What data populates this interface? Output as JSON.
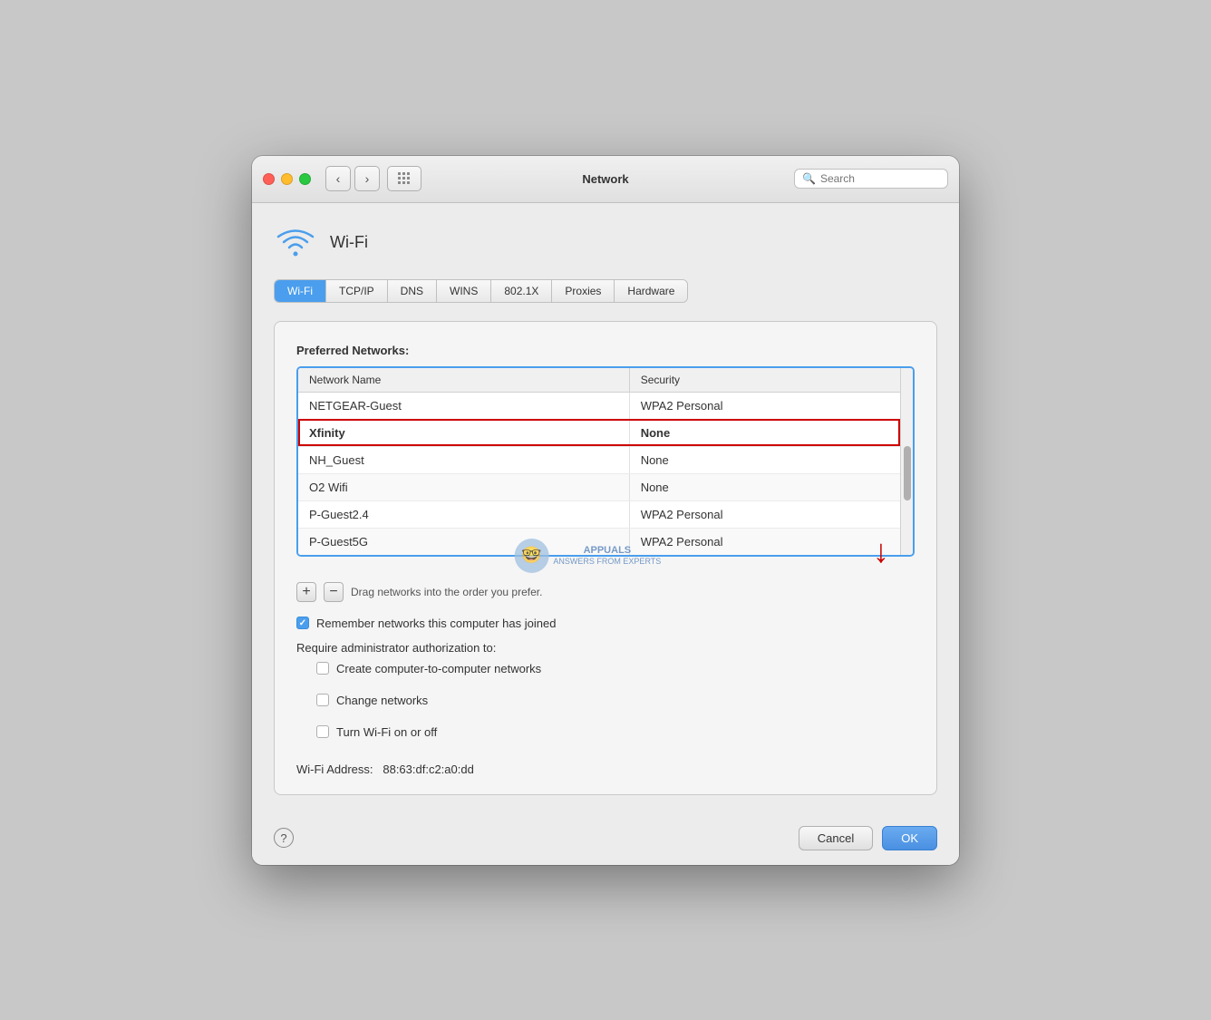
{
  "window": {
    "title": "Network",
    "search_placeholder": "Search"
  },
  "titlebar": {
    "back_label": "‹",
    "forward_label": "›"
  },
  "wifi_header": {
    "label": "Wi-Fi"
  },
  "tabs": [
    {
      "label": "Wi-Fi",
      "active": true
    },
    {
      "label": "TCP/IP"
    },
    {
      "label": "DNS"
    },
    {
      "label": "WINS"
    },
    {
      "label": "802.1X"
    },
    {
      "label": "Proxies"
    },
    {
      "label": "Hardware"
    }
  ],
  "preferred_networks": {
    "section_label": "Preferred Networks:",
    "columns": [
      "Network Name",
      "Security"
    ],
    "rows": [
      {
        "name": "NETGEAR-Guest",
        "security": "WPA2 Personal",
        "highlighted": false
      },
      {
        "name": "Xfinity",
        "security": "None",
        "highlighted": true
      },
      {
        "name": "NH_Guest",
        "security": "None",
        "highlighted": false
      },
      {
        "name": "O2 Wifi",
        "security": "None",
        "highlighted": false
      },
      {
        "name": "P-Guest2.4",
        "security": "WPA2 Personal",
        "highlighted": false
      },
      {
        "name": "P-Guest5G",
        "security": "WPA2 Personal",
        "highlighted": false
      }
    ],
    "drag_hint": "Drag networks into the order you prefer."
  },
  "remember_networks": {
    "label": "Remember networks this computer has joined",
    "checked": true
  },
  "require_admin": {
    "label": "Require administrator authorization to:",
    "options": [
      {
        "label": "Create computer-to-computer networks",
        "checked": false
      },
      {
        "label": "Change networks",
        "checked": false
      },
      {
        "label": "Turn Wi-Fi on or off",
        "checked": false
      }
    ]
  },
  "wifi_address": {
    "label": "Wi-Fi Address:",
    "value": "88:63:df:c2:a0:dd"
  },
  "bottom": {
    "help_label": "?",
    "cancel_label": "Cancel",
    "ok_label": "OK"
  }
}
